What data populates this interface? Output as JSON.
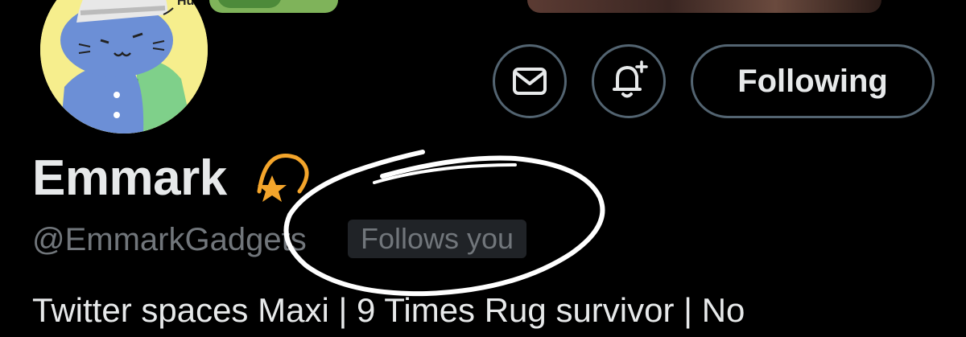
{
  "profile": {
    "display_name": "Emmark",
    "handle": "@EmmarkGadgets",
    "follows_you_label": "Follows you",
    "bio_line": "Twitter spaces Maxi | 9 Times Rug survivor | No",
    "avatar_text": "Huh"
  },
  "actions": {
    "message_icon": "mail-icon",
    "notify_icon": "bell-plus-icon",
    "following_label": "Following"
  },
  "colors": {
    "background": "#000000",
    "text_primary": "#e7e9ea",
    "text_secondary": "#71767b",
    "button_border": "#536471",
    "follows_you_bg": "#202327",
    "avatar_bg": "#f6ee8d",
    "badge_star": "#f4a52b"
  }
}
